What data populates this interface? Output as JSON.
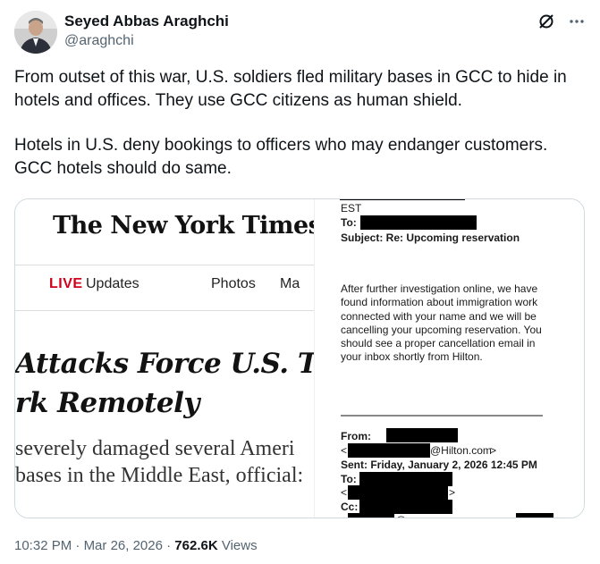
{
  "author": {
    "display_name": "Seyed Abbas Araghchi",
    "handle": "@araghchi"
  },
  "actions": {
    "grok_icon": "grok-icon",
    "more_icon": "more-horizontal-icon"
  },
  "tweet": {
    "paragraph_1": "From outset of this war, U.S. soldiers fled military bases in GCC to hide in hotels and offices. They use GCC citizens as human shield.",
    "paragraph_2": "Hotels in U.S. deny bookings to officers who may endanger customers. GCC hotels should do same."
  },
  "media": {
    "nyt": {
      "logo": "The New York Times",
      "live": "LIVE",
      "updates": "Updates",
      "photos": "Photos",
      "nav_more": "Ma",
      "headline_line1": "Attacks Force U.S. Tr",
      "headline_line2": "rk Remotely",
      "summary_line1": "severely damaged several Ameri",
      "summary_line2": "bases in the Middle East, official:"
    },
    "email": {
      "top_est": "EST",
      "to_label": "To:",
      "subject": "Subject: Re: Upcoming reservation",
      "body": "After further investigation online, we have found information about immigration work connected with your name and we will be cancelling your upcoming reservation. You should see a proper cancellation email in your inbox shortly from Hilton.",
      "from_label": "From:",
      "lt": "<",
      "hilton_domain": "@Hilton.com",
      "gt": ">",
      "sent": "Sent: Friday, January 2, 2026 12:45 PM",
      "to2_label": "To:",
      "cc_label": "Cc:",
      "cc_partial": "@..."
    }
  },
  "meta": {
    "time": "10:32 PM",
    "separator": "·",
    "date": "Mar 26, 2026",
    "views_count": "762.6K",
    "views_label": "Views"
  },
  "colors": {
    "text": "#0f1419",
    "secondary": "#536471",
    "border": "#cfd9de",
    "nyt_live_red": "#d0021b"
  }
}
